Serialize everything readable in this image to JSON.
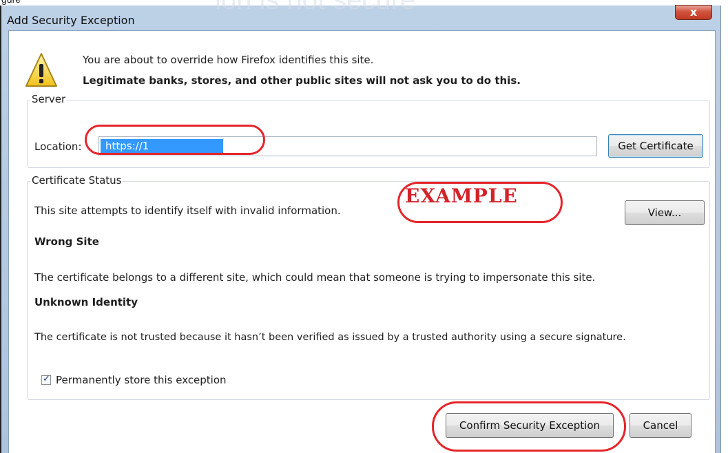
{
  "background_caption": "gure",
  "background_ghost_text": "ion is not secure",
  "window": {
    "title": "Add Security Exception",
    "close_glyph": "x"
  },
  "intro": {
    "line1": "You are about to override how Firefox identifies this site.",
    "line2": "Legitimate banks, stores, and other public sites will not ask you to do this."
  },
  "server": {
    "group_label": "Server",
    "location_label": "Location:",
    "location_value": "https://1",
    "get_certificate_label": "Get Certificate"
  },
  "certificate_status": {
    "group_label": "Certificate Status",
    "summary": "This site attempts to identify itself with invalid information.",
    "view_button_label": "View...",
    "wrong_site_heading": "Wrong Site",
    "wrong_site_text": "The certificate belongs to a different site, which could mean that someone is trying to impersonate this site.",
    "unknown_identity_heading": "Unknown Identity",
    "unknown_identity_text": "The certificate is not trusted because it hasn’t been verified as issued by a trusted authority using a secure signature."
  },
  "permanent_store": {
    "checked": true,
    "label": "Permanently store this exception"
  },
  "buttons": {
    "confirm_label": "Confirm Security Exception",
    "cancel_label": "Cancel"
  },
  "annotation": {
    "example_label": "EXAMPLE",
    "highlight_color": "#e5252a"
  },
  "colors": {
    "selection": "#3399ff",
    "title_bar": "#bcd0e6",
    "close_button": "#c9432e"
  }
}
